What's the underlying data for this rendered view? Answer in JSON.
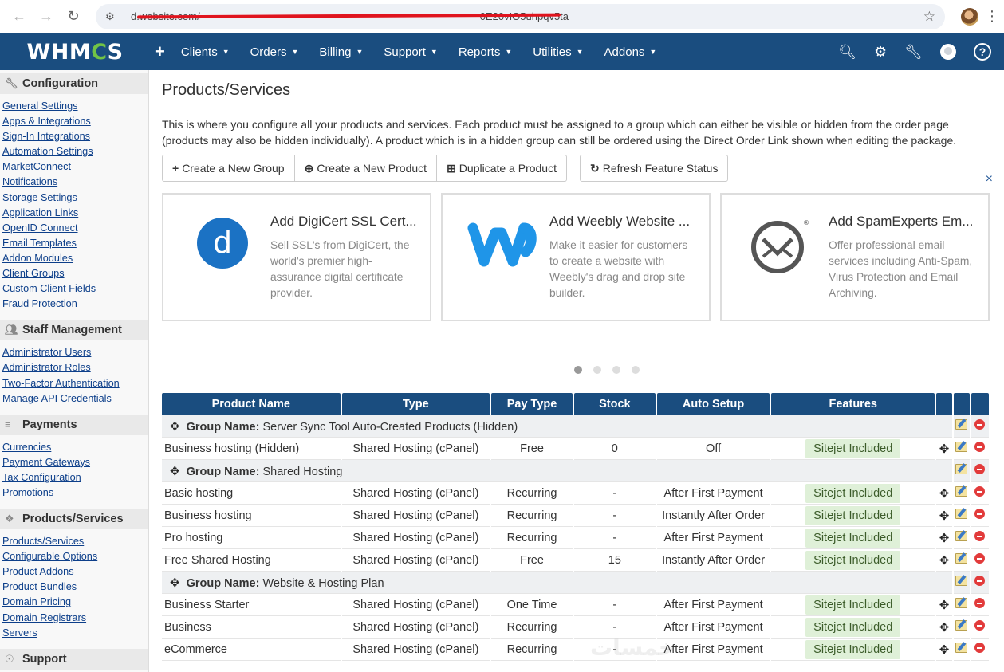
{
  "browser": {
    "url": "demo.website.com/admin/configproducts.php?nocache=0E20vIO5uhpqv5ta",
    "url_visible": "d.website.com/",
    "url_tail": "0E20vIO5uhpqv5ta"
  },
  "topnav": {
    "logo": "WHMCS",
    "logo_left": "WHM",
    "logo_gear": "C",
    "logo_right": "S",
    "plus": "+",
    "menu": [
      "Clients",
      "Orders",
      "Billing",
      "Support",
      "Reports",
      "Utilities",
      "Addons"
    ]
  },
  "sidebar": {
    "sections": [
      {
        "title": "Configuration",
        "icon": "wrench-icon",
        "links": [
          "General Settings",
          "Apps & Integrations",
          "Sign-In Integrations",
          "Automation Settings",
          "MarketConnect",
          "Notifications",
          "Storage Settings",
          "Application Links",
          "OpenID Connect",
          "Email Templates",
          "Addon Modules",
          "Client Groups",
          "Custom Client Fields",
          "Fraud Protection"
        ]
      },
      {
        "title": "Staff Management",
        "icon": "users-icon",
        "links": [
          "Administrator Users",
          "Administrator Roles",
          "Two-Factor Authentication",
          "Manage API Credentials"
        ]
      },
      {
        "title": "Payments",
        "icon": "money-icon",
        "links": [
          "Currencies",
          "Payment Gateways",
          "Tax Configuration",
          "Promotions"
        ]
      },
      {
        "title": "Products/Services",
        "icon": "cubes-icon",
        "links": [
          "Products/Services",
          "Configurable Options",
          "Product Addons",
          "Product Bundles",
          "Domain Pricing",
          "Domain Registrars",
          "Servers"
        ]
      },
      {
        "title": "Support",
        "icon": "lifebuoy-icon",
        "links": []
      }
    ]
  },
  "main": {
    "title": "Products/Services",
    "intro": "This is where you configure all your products and services. Each product must be assigned to a group which can either be visible or hidden from the order page (products may also be hidden individually). A product which is in a hidden group can still be ordered using the Direct Order Link shown when editing the package.",
    "buttons": {
      "create_group": "Create a New Group",
      "create_product": "Create a New Product",
      "duplicate": "Duplicate a Product",
      "refresh": "Refresh Feature Status"
    },
    "close": "×",
    "promos": [
      {
        "title": "Add DigiCert SSL Cert...",
        "desc": "Sell SSL's from DigiCert, the world's premier high-assurance digital certificate provider.",
        "logo": "digicert-logo",
        "logo_letter": "d"
      },
      {
        "title": "Add Weebly Website ...",
        "desc": "Make it easier for customers to create a website with Weebly's drag and drop site builder.",
        "logo": "weebly-logo"
      },
      {
        "title": "Add SpamExperts Em...",
        "desc": "Offer professional email services including Anti-Spam, Virus Protection and Email Archiving.",
        "logo": "spamexperts-logo",
        "logo_mark": "®"
      }
    ],
    "carousel_active": 0,
    "carousel_count": 4
  },
  "table": {
    "headers": [
      "Product Name",
      "Type",
      "Pay Type",
      "Stock",
      "Auto Setup",
      "Features"
    ],
    "group_label": "Group Name:",
    "groups": [
      {
        "name": "Server Sync Tool Auto-Created Products (Hidden)",
        "rows": [
          {
            "name": "Business hosting (Hidden)",
            "type": "Shared Hosting (cPanel)",
            "pay": "Free",
            "stock": "0",
            "auto": "Off",
            "feature": "Sitejet Included"
          }
        ]
      },
      {
        "name": "Shared Hosting",
        "rows": [
          {
            "name": "Basic hosting",
            "type": "Shared Hosting (cPanel)",
            "pay": "Recurring",
            "stock": "-",
            "auto": "After First Payment",
            "feature": "Sitejet Included"
          },
          {
            "name": "Business hosting",
            "type": "Shared Hosting (cPanel)",
            "pay": "Recurring",
            "stock": "-",
            "auto": "Instantly After Order",
            "feature": "Sitejet Included"
          },
          {
            "name": "Pro hosting",
            "type": "Shared Hosting (cPanel)",
            "pay": "Recurring",
            "stock": "-",
            "auto": "After First Payment",
            "feature": "Sitejet Included"
          },
          {
            "name": "Free Shared Hosting",
            "type": "Shared Hosting (cPanel)",
            "pay": "Free",
            "stock": "15",
            "auto": "Instantly After Order",
            "feature": "Sitejet Included"
          }
        ]
      },
      {
        "name": "Website & Hosting Plan",
        "rows": [
          {
            "name": "Business Starter",
            "type": "Shared Hosting (cPanel)",
            "pay": "One Time",
            "stock": "-",
            "auto": "After First Payment",
            "feature": "Sitejet Included"
          },
          {
            "name": "Business",
            "type": "Shared Hosting (cPanel)",
            "pay": "Recurring",
            "stock": "-",
            "auto": "After First Payment",
            "feature": "Sitejet Included"
          },
          {
            "name": "eCommerce",
            "type": "Shared Hosting (cPanel)",
            "pay": "Recurring",
            "stock": "-",
            "auto": "After First Payment",
            "feature": "Sitejet Included"
          }
        ]
      }
    ]
  },
  "colors": {
    "nav": "#1a4d7f",
    "accent_green": "#71c346",
    "link": "#0d3f8a",
    "badge_bg": "#dff0d8"
  }
}
